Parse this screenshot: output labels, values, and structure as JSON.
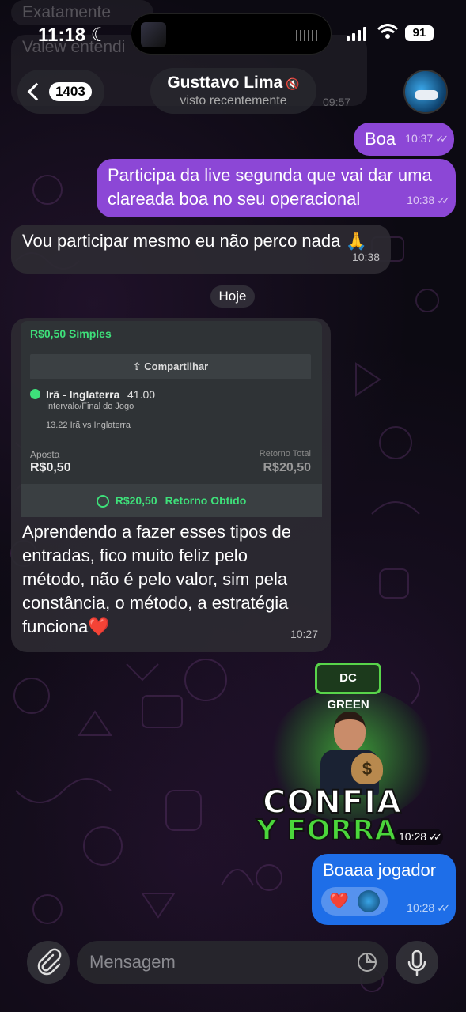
{
  "status_bar": {
    "time": "11:18",
    "battery": "91"
  },
  "ghost_messages": [
    "Exatamente",
    "Valew entendi"
  ],
  "header": {
    "back_count": "1403",
    "contact_name": "Gusttavo Lima",
    "contact_status": "visto recentemente",
    "ghost_time": "09:57"
  },
  "messages": [
    {
      "text": "Boa",
      "time": "10:37"
    },
    {
      "text": "Participa da live segunda que vai dar uma clareada boa no seu operacional",
      "time": "10:38"
    },
    {
      "text": "Vou participar mesmo eu não perco nada 🙏",
      "time": "10:38"
    }
  ],
  "date_chip": "Hoje",
  "bet_card": {
    "title": "R$0,50 Simples",
    "share_label": "Compartilhar",
    "match": "Irã - Inglaterra",
    "odd": "41.00",
    "market": "Intervalo/Final do Jogo",
    "event": "13.22 Irã vs Inglaterra",
    "stake_label": "Aposta",
    "stake_value": "R$0,50",
    "return_label": "Retorno Total",
    "return_value": "R$20,50",
    "result_value": "R$20,50",
    "result_label": "Retorno Obtido"
  },
  "image_caption": {
    "text": "Aprendendo a fazer esses tipos de entradas, fico muito feliz pelo método, não é pelo valor, sim pela constância, o método, a estratégia funciona❤️",
    "time": "10:27"
  },
  "sticker": {
    "badge": "DC GREEN",
    "line1": "CONFIA",
    "line2": "Y FORRA",
    "time": "10:28"
  },
  "last_message": {
    "text": "Boaaa jogador",
    "reaction": "❤️",
    "time": "10:28"
  },
  "composer": {
    "placeholder": "Mensagem"
  },
  "colors": {
    "outgoing": "#8c47d6",
    "outgoing_last": "#1e6ee8",
    "incoming": "#2c2a32",
    "green": "#3ee07a"
  }
}
